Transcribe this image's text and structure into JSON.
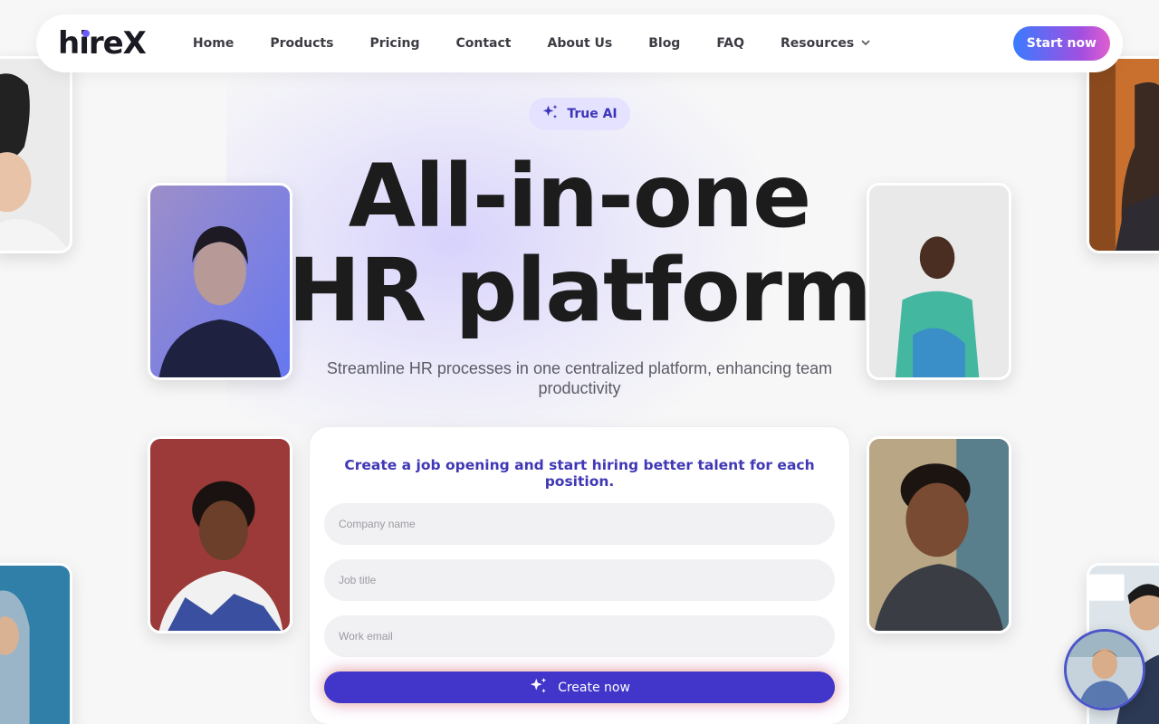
{
  "brand": {
    "logo_text": "hireX",
    "accent": "#6b5cff"
  },
  "nav": {
    "links": [
      {
        "label": "Home"
      },
      {
        "label": "Products"
      },
      {
        "label": "Pricing"
      },
      {
        "label": "Contact"
      },
      {
        "label": "About Us"
      },
      {
        "label": "Blog"
      },
      {
        "label": "FAQ"
      },
      {
        "label": "Resources",
        "dropdown": true
      }
    ],
    "cta_label": "Start now"
  },
  "hero": {
    "badge": "True AI",
    "headline_line1": "All-in-one",
    "headline_line2": "HR platform",
    "subtitle": "Streamline HR processes in one centralized platform, enhancing team productivity"
  },
  "form": {
    "title": "Create a job opening and start hiring better talent for each position.",
    "fields": [
      {
        "placeholder": "Company name",
        "value": ""
      },
      {
        "placeholder": "Job title",
        "value": ""
      },
      {
        "placeholder": "Work email",
        "value": ""
      }
    ],
    "submit_label": "Create now",
    "button_color": "#4136c9"
  },
  "icons": {
    "badge_icon": "sparkles-icon",
    "submit_icon": "sparkles-icon",
    "dropdown_icon": "chevron-down-icon"
  }
}
